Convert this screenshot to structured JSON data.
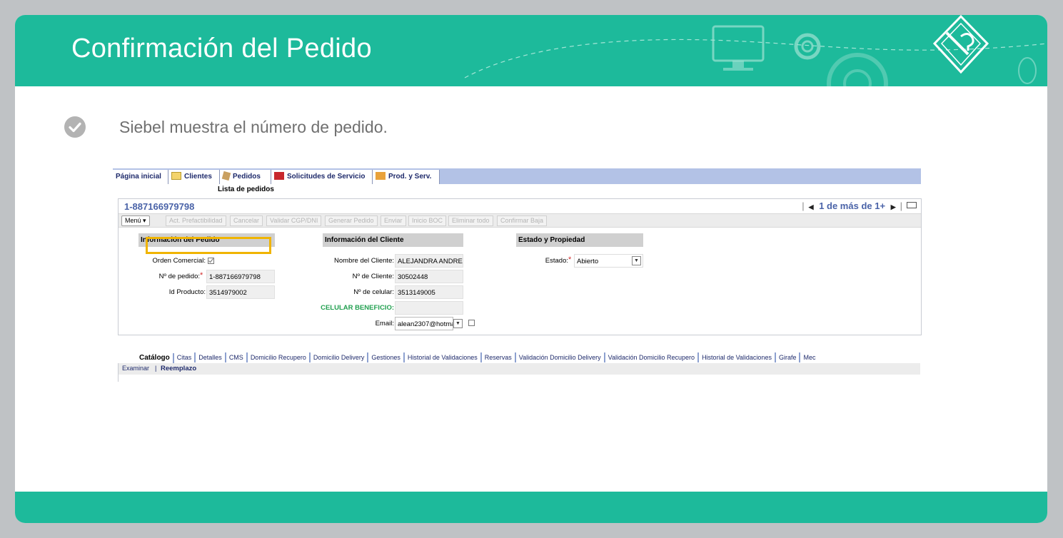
{
  "header": {
    "title": "Confirmación del Pedido"
  },
  "bullet": {
    "text": "Siebel muestra el número de pedido."
  },
  "siebel": {
    "tabs": [
      "Página inicial",
      "Clientes",
      "Pedidos",
      "Solicitudes de Servicio",
      "Prod. y Serv."
    ],
    "subnav": "Lista de pedidos",
    "record_id": "1-887166979798",
    "pager": "1 de más de 1+",
    "menu_label": "Menú ▾",
    "toolbar_buttons": [
      "Act. Prefactibilidad",
      "Cancelar",
      "Validar CGP/DNI",
      "Generar Pedido",
      "Enviar",
      "Inicio BOC",
      "Eliminar todo",
      "Confirmar Baja"
    ],
    "sections": {
      "pedido": "Información del Pedido",
      "cliente": "Información del Cliente",
      "estado": "Estado y Propiedad"
    },
    "labels": {
      "orden_comercial": "Orden Comercial:",
      "nro_pedido": "Nº de pedido:",
      "id_producto": "Id Producto:",
      "nombre_cliente": "Nombre del Cliente:",
      "nro_cliente": "Nº de Cliente:",
      "nro_celular": "Nº de celular:",
      "celular_beneficio": "CELULAR BENEFICIO:",
      "email": "Email:",
      "estado": "Estado:"
    },
    "values": {
      "nro_pedido": "1-887166979798",
      "id_producto": "3514979002",
      "nombre_cliente": "ALEJANDRA ANDREA I",
      "nro_cliente": "30502448",
      "nro_celular": "3513149005",
      "celular_beneficio": "",
      "email": "alean2307@hotma",
      "estado": "Abierto"
    },
    "view_tabs": [
      "Catálogo",
      "Citas",
      "Detalles",
      "CMS",
      "Domicilio Recupero",
      "Domicilio Delivery",
      "Gestiones",
      "Historial de Validaciones",
      "Reservas",
      "Validación Domicilio Delivery",
      "Validación Domicilio Recupero",
      "Historial de Validaciones",
      "Girafe",
      "Mec"
    ],
    "bottom_links": {
      "examinar": "Examinar",
      "reemplazo": "Reemplazo"
    }
  },
  "colors": {
    "accent": "#1dba9b",
    "highlight": "#f0b400",
    "tab_bar": "#b3c2e6"
  }
}
